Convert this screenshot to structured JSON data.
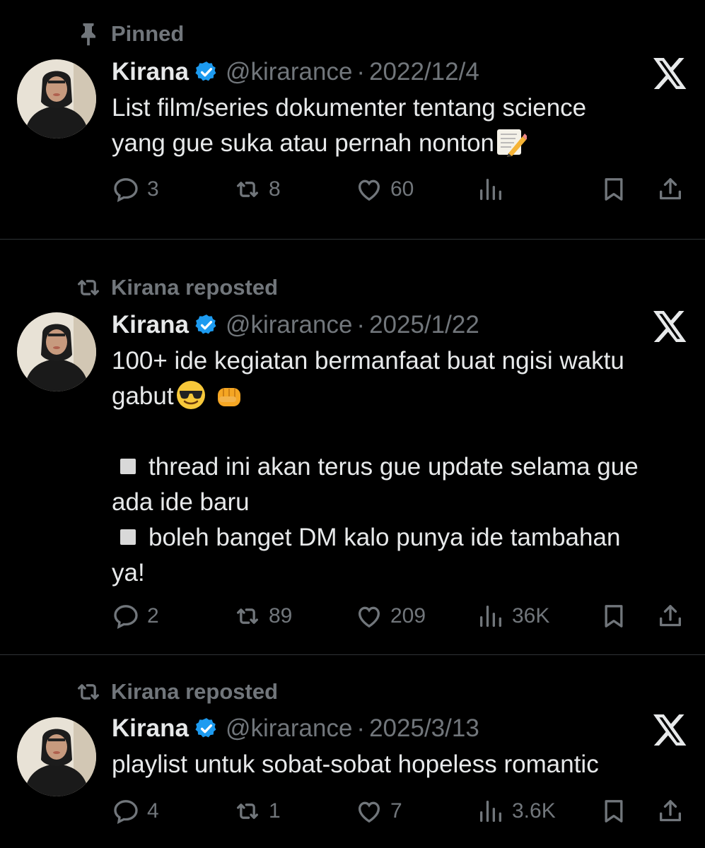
{
  "tweets": [
    {
      "context": "Pinned",
      "name": "Kirana",
      "handle": "@kirarance",
      "separator": "·",
      "date": "2022/12/4",
      "lines": [
        "List film/series dokumenter tentang science",
        "yang gue suka atau pernah nonton"
      ],
      "replies": "3",
      "reposts": "8",
      "likes": "60",
      "views": ""
    },
    {
      "context": "Kirana reposted",
      "name": "Kirana",
      "handle": "@kirarance",
      "separator": "·",
      "date": "2025/1/22",
      "lines": [
        "100+ ide kegiatan bermanfaat buat ngisi waktu",
        "gabut",
        "",
        "thread ini akan terus gue update selama gue",
        "ada ide baru",
        "boleh banget DM kalo punya ide tambahan",
        "ya!"
      ],
      "replies": "2",
      "reposts": "89",
      "likes": "209",
      "views": "36K"
    },
    {
      "context": "Kirana reposted",
      "name": "Kirana",
      "handle": "@kirarance",
      "separator": "·",
      "date": "2025/3/13",
      "lines": [
        "playlist untuk sobat-sobat hopeless romantic"
      ],
      "replies": "4",
      "reposts": "1",
      "likes": "7",
      "views": "3.6K"
    }
  ],
  "icons": {
    "pin": "pin-icon",
    "repost": "repost-icon",
    "verified": "verified-badge-icon",
    "platform": "x-logo-icon",
    "reply": "reply-icon",
    "like": "heart-icon",
    "views": "views-icon",
    "bookmark": "bookmark-icon",
    "share": "share-icon"
  },
  "colors": {
    "background": "#000000",
    "text": "#e7e9ea",
    "muted": "#71767b",
    "verified": "#1d9bf0",
    "divider": "#2f3336"
  }
}
